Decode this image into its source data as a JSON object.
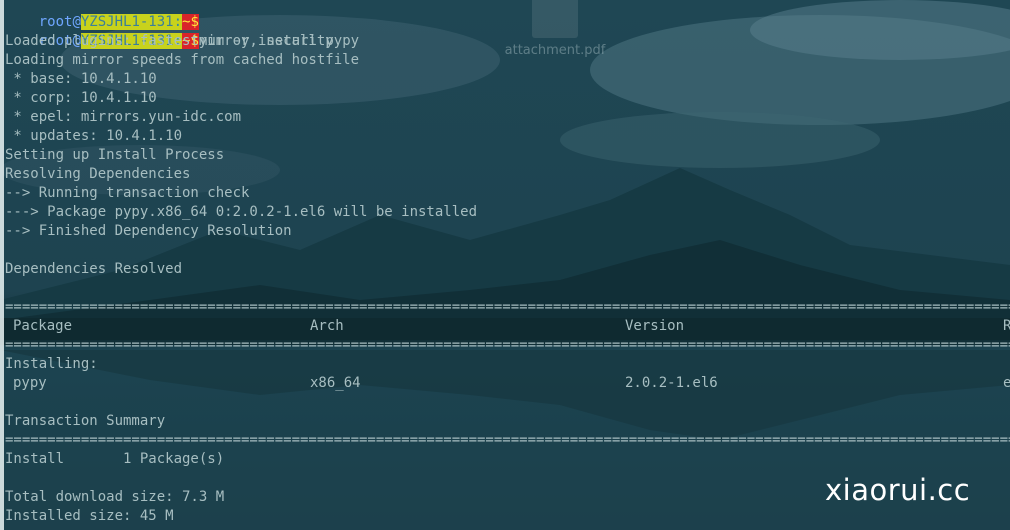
{
  "desktop": {
    "file_label": "attachment.pdf",
    "watermark": "xiaorui.cc"
  },
  "prompt": {
    "user": "root",
    "at": "@",
    "host": "YZSJHL1-131",
    "sep": ":",
    "path": "~",
    "symbol": "$"
  },
  "command": "yum -y install pypy",
  "output": [
    "Loaded plugins: fastestmirror, security",
    "Loading mirror speeds from cached hostfile",
    " * base: 10.4.1.10",
    " * corp: 10.4.1.10",
    " * epel: mirrors.yun-idc.com",
    " * updates: 10.4.1.10",
    "Setting up Install Process",
    "Resolving Dependencies",
    "--> Running transaction check",
    "---> Package pypy.x86_64 0:2.0.2-1.el6 will be installed",
    "--> Finished Dependency Resolution",
    "",
    "Dependencies Resolved"
  ],
  "table": {
    "headers": [
      "Package",
      "Arch",
      "Version",
      "R"
    ],
    "section": "Installing:",
    "rows": [
      [
        "pypy",
        "x86_64",
        "2.0.2-1.el6",
        "e"
      ]
    ]
  },
  "summary": {
    "title": "Transaction Summary",
    "install_line": "Install       1 Package(s)",
    "download_size": "Total download size: 7.3 M",
    "installed_size": "Installed size: 45 M"
  }
}
